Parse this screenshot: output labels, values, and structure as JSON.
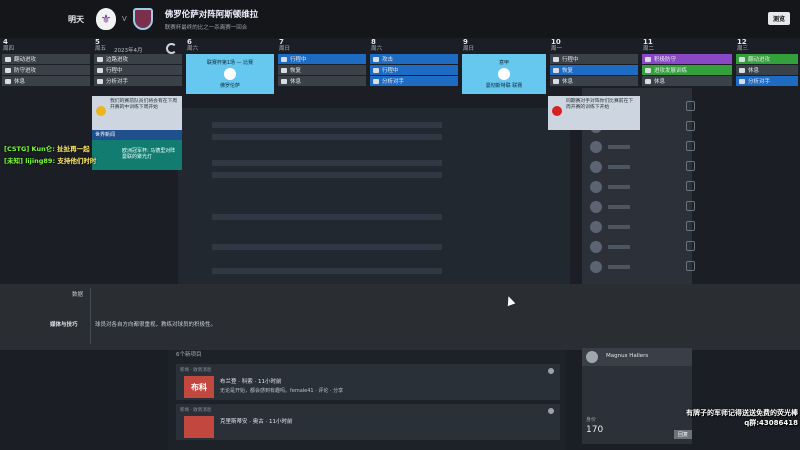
{
  "header": {
    "day_label": "明天",
    "vs_label": "V",
    "match_title": "佛罗伦萨对阵阿斯顿维拉",
    "match_subtitle": "联赛杯最终的比之一杀离赛一回合",
    "top_button": "测览"
  },
  "calendar": {
    "month_label": "2023年4月",
    "columns": [
      {
        "num": "4",
        "weekday": "周四",
        "slots": [
          {
            "label": "翻动进攻",
            "style": "dark"
          },
          {
            "label": "防守进攻",
            "style": "dark"
          },
          {
            "label": "休息",
            "style": "dark"
          }
        ]
      },
      {
        "num": "5",
        "weekday": "周五",
        "slots": [
          {
            "label": "边路进攻",
            "style": "dark"
          },
          {
            "label": "行程中",
            "style": "dark"
          },
          {
            "label": "分析对手",
            "style": "dark"
          }
        ]
      },
      {
        "num": "6",
        "weekday": "周六",
        "slots": []
      },
      {
        "num": "7",
        "weekday": "周日",
        "slots": [
          {
            "label": "行程中",
            "style": "blue"
          },
          {
            "label": "恢复",
            "style": "dark"
          },
          {
            "label": "休息",
            "style": "dark"
          }
        ]
      },
      {
        "num": "8",
        "weekday": "周六",
        "slots": [
          {
            "label": "攻击",
            "style": "blue"
          },
          {
            "label": "行程中",
            "style": "blue"
          },
          {
            "label": "分析对手",
            "style": "blue"
          }
        ]
      },
      {
        "num": "9",
        "weekday": "周日",
        "slots": []
      },
      {
        "num": "10",
        "weekday": "周一",
        "slots": [
          {
            "label": "行程中",
            "style": "dark"
          },
          {
            "label": "恢复",
            "style": "blue"
          },
          {
            "label": "休息",
            "style": "dark"
          }
        ]
      },
      {
        "num": "11",
        "weekday": "周二",
        "slots": [
          {
            "label": "积极防守",
            "style": "purple"
          },
          {
            "label": "进攻发展训练",
            "style": "green"
          },
          {
            "label": "休息",
            "style": "dark"
          }
        ]
      },
      {
        "num": "12",
        "weekday": "周三",
        "slots": [
          {
            "label": "翻动进攻",
            "style": "green"
          },
          {
            "label": "休息",
            "style": "dark"
          },
          {
            "label": "分析对手",
            "style": "blue"
          }
        ]
      }
    ],
    "match_cards": [
      {
        "top": "联赛杯第1场 — 比赛",
        "bottom": "佛罗伦萨"
      },
      {
        "top": "意甲",
        "bottom": "曼彻斯特联 联赛"
      }
    ]
  },
  "notes": {
    "note1": "我们的赛前队员们将会有在下周开赛的中训练下周开始",
    "chip": "世界新闻",
    "teal": "欧洲冠军杯: 马德里对阵曼联的聚光灯",
    "note2": "同期赛对手对阵你们比赛前在下周开赛的训练下开始"
  },
  "chat": [
    {
      "name": "[CSTG] Kun仑:",
      "msg": "扯扯再一起"
    },
    {
      "name": "[未知] lijing89:",
      "msg": "支持他们时时"
    }
  ],
  "bottom": {
    "label1": "数据",
    "label2": "媒体与技巧",
    "text2": "球员对各自方向都很重视，教练对球员的积极性。"
  },
  "lower": {
    "count_label": "6个新项目",
    "news": [
      {
        "source": "新闻 · 收到消息",
        "thumb": "布科",
        "name": "布兰登 · 科索 · 11小时前",
        "body": "无论是开始，都会感到有趣吗。female41 · 评论 · 分享"
      },
      {
        "source": "新闻 · 收到消息",
        "thumb": "",
        "name": "克里斯蒂安 · 奥古 · 11小时前",
        "body": ""
      }
    ]
  },
  "player": {
    "name": "Magnus Hallers"
  },
  "stat": {
    "label": "身价",
    "value": "170",
    "button": "回复"
  },
  "overlay": {
    "line1": "有牌子的军师记得送送免费的荧光棒",
    "line2": "q群:43086418"
  }
}
